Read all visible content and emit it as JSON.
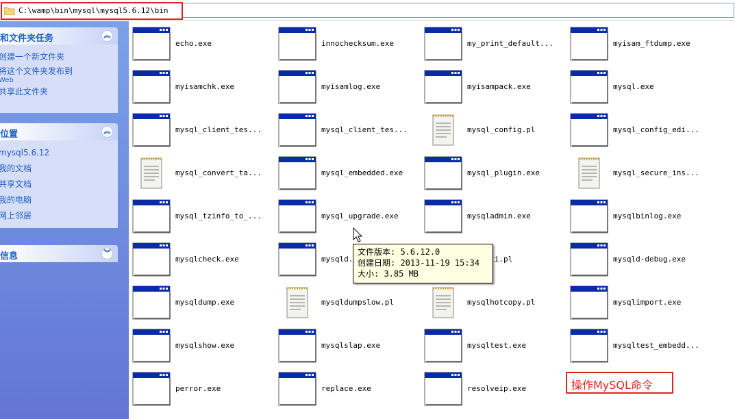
{
  "address": {
    "path": "C:\\wamp\\bin\\mysql\\mysql5.6.12\\bin"
  },
  "taskpane": {
    "tasks": {
      "title": "和文件夹任务",
      "toggle": "︽",
      "links": [
        "创建一个新文件夹",
        "将这个文件夹发布到"
      ],
      "link_small": "Web",
      "link_last": "共享此文件夹"
    },
    "places": {
      "title": "位置",
      "toggle": "︽",
      "links": [
        "mysql5.6.12",
        "我的文档",
        "共享文档",
        "我的电脑",
        "网上邻居"
      ]
    },
    "details": {
      "title": "信息",
      "toggle": "︾"
    }
  },
  "files": [
    {
      "label": "echo.exe",
      "icon": "exe-window-icon"
    },
    {
      "label": "innochecksum.exe",
      "icon": "exe-window-icon"
    },
    {
      "label": "my_print_default...",
      "icon": "exe-window-icon"
    },
    {
      "label": "myisam_ftdump.exe",
      "icon": "exe-window-icon"
    },
    {
      "label": "myisamchk.exe",
      "icon": "exe-window-icon"
    },
    {
      "label": "myisamlog.exe",
      "icon": "exe-window-icon"
    },
    {
      "label": "myisampack.exe",
      "icon": "exe-window-icon"
    },
    {
      "label": "mysql.exe",
      "icon": "exe-window-icon"
    },
    {
      "label": "mysql_client_tes...",
      "icon": "exe-window-icon"
    },
    {
      "label": "mysql_client_tes...",
      "icon": "exe-window-icon"
    },
    {
      "label": "mysql_config.pl",
      "icon": "notepad-document-icon"
    },
    {
      "label": "mysql_config_edi...",
      "icon": "exe-window-icon"
    },
    {
      "label": "mysql_convert_ta...",
      "icon": "notepad-document-icon"
    },
    {
      "label": "mysql_embedded.exe",
      "icon": "exe-window-icon"
    },
    {
      "label": "mysql_plugin.exe",
      "icon": "exe-window-icon"
    },
    {
      "label": "mysql_secure_ins...",
      "icon": "notepad-document-icon"
    },
    {
      "label": "mysql_tzinfo_to_...",
      "icon": "exe-window-icon"
    },
    {
      "label": "mysql_upgrade.exe",
      "icon": "exe-window-icon"
    },
    {
      "label": "mysqladmin.exe",
      "icon": "exe-window-icon"
    },
    {
      "label": "mysqlbinlog.exe",
      "icon": "exe-window-icon"
    },
    {
      "label": "mysqlcheck.exe",
      "icon": "exe-window-icon"
    },
    {
      "label": "mysqld.",
      "icon": "exe-window-icon"
    },
    {
      "label": "d_multi.pl",
      "icon": "notepad-document-icon"
    },
    {
      "label": "mysqld-debug.exe",
      "icon": "exe-window-icon"
    },
    {
      "label": "mysqldump.exe",
      "icon": "exe-window-icon"
    },
    {
      "label": "mysqldumpslow.pl",
      "icon": "notepad-document-icon"
    },
    {
      "label": "mysqlhotcopy.pl",
      "icon": "notepad-document-icon"
    },
    {
      "label": "mysqlimport.exe",
      "icon": "exe-window-icon"
    },
    {
      "label": "mysqlshow.exe",
      "icon": "exe-window-icon"
    },
    {
      "label": "mysqlslap.exe",
      "icon": "exe-window-icon"
    },
    {
      "label": "mysqltest.exe",
      "icon": "exe-window-icon"
    },
    {
      "label": "mysqltest_embedd...",
      "icon": "exe-window-icon"
    },
    {
      "label": "perror.exe",
      "icon": "exe-window-icon"
    },
    {
      "label": "replace.exe",
      "icon": "exe-window-icon"
    },
    {
      "label": "resolveip.exe",
      "icon": "exe-window-icon"
    }
  ],
  "tooltip": {
    "version": "文件版本: 5.6.12.0",
    "created": "创建日期: 2013-11-19 15:34",
    "size": "大小: 3.85 MB"
  },
  "annotation": {
    "text": "操作MySQL命令"
  },
  "colors": {
    "accent_red": "#e02424",
    "xp_blue": "#215dc6",
    "title_bar_blue": "#0a2ba8"
  }
}
